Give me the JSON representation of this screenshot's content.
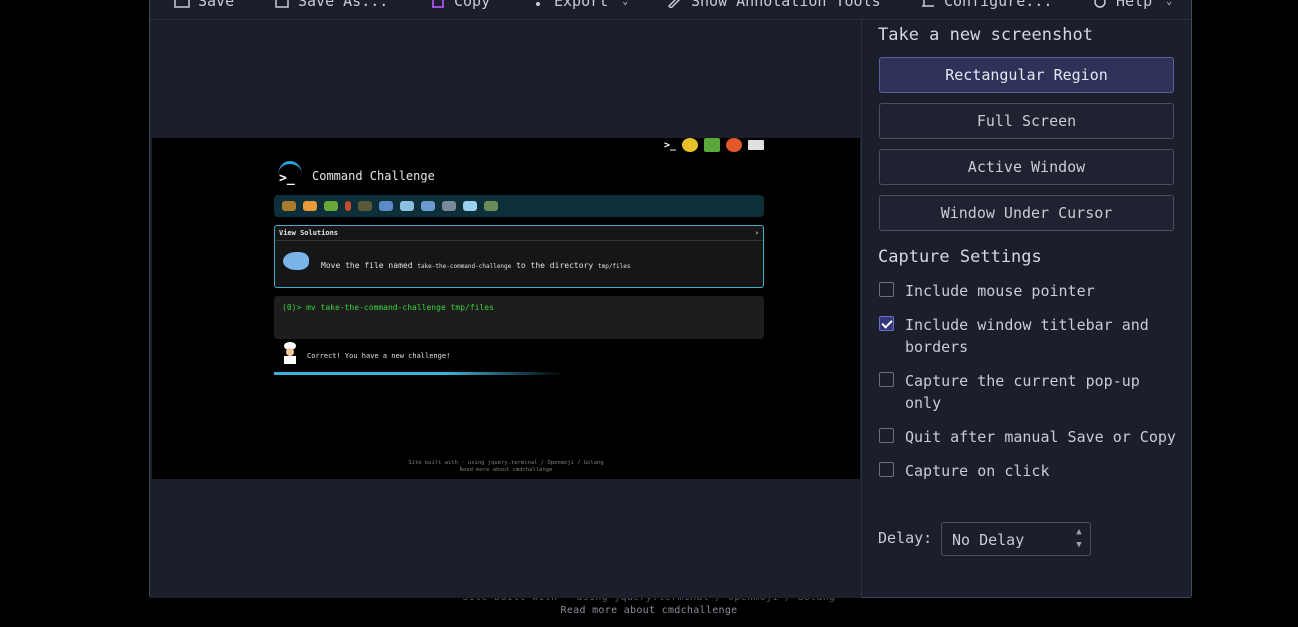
{
  "background_page": {
    "footer_line1": "Site built with · using jquery.terminal / openmoji / Golang",
    "footer_line2": "Read more about cmdchallenge"
  },
  "toolbar": {
    "save_label": "Save",
    "save_as_label": "Save As...",
    "copy_label": "Copy",
    "export_label": "Export",
    "annotation_label": "Show Annotation Tools",
    "configure_label": "Configure...",
    "help_label": "Help"
  },
  "preview": {
    "title": "Command Challenge",
    "view_solutions": "View Solutions",
    "challenge_prefix": "Move the file named",
    "challenge_file": "take-the-command-challenge",
    "challenge_mid": "to the directory",
    "challenge_dir": "tmp/files",
    "terminal_line": "(0)> mv take-the-command-challenge tmp/files",
    "correct_message": "Correct! You have a new challenge!",
    "footer_line1": "Site built with · using jquery.terminal / Openmoji / Golang",
    "footer_line2": "Read more about cmdchallenge"
  },
  "panel": {
    "new_screenshot_title": "Take a new screenshot",
    "buttons": [
      {
        "label": "Rectangular Region",
        "active": true
      },
      {
        "label": "Full Screen",
        "active": false
      },
      {
        "label": "Active Window",
        "active": false
      },
      {
        "label": "Window Under Cursor",
        "active": false
      }
    ],
    "settings_title": "Capture Settings",
    "options": [
      {
        "label": "Include mouse pointer",
        "checked": false
      },
      {
        "label": "Include window titlebar and borders",
        "checked": true
      },
      {
        "label": "Capture the current pop-up only",
        "checked": false
      },
      {
        "label": "Quit after manual Save or Copy",
        "checked": false
      },
      {
        "label": "Capture on click",
        "checked": false
      }
    ],
    "delay_label": "Delay:",
    "delay_value": "No Delay"
  },
  "colors": {
    "window_bg": "#1b1e2b",
    "accent_button": "#2f3258",
    "terminal_green": "#3ad23a",
    "cyan_accent": "#3fb0d8"
  }
}
